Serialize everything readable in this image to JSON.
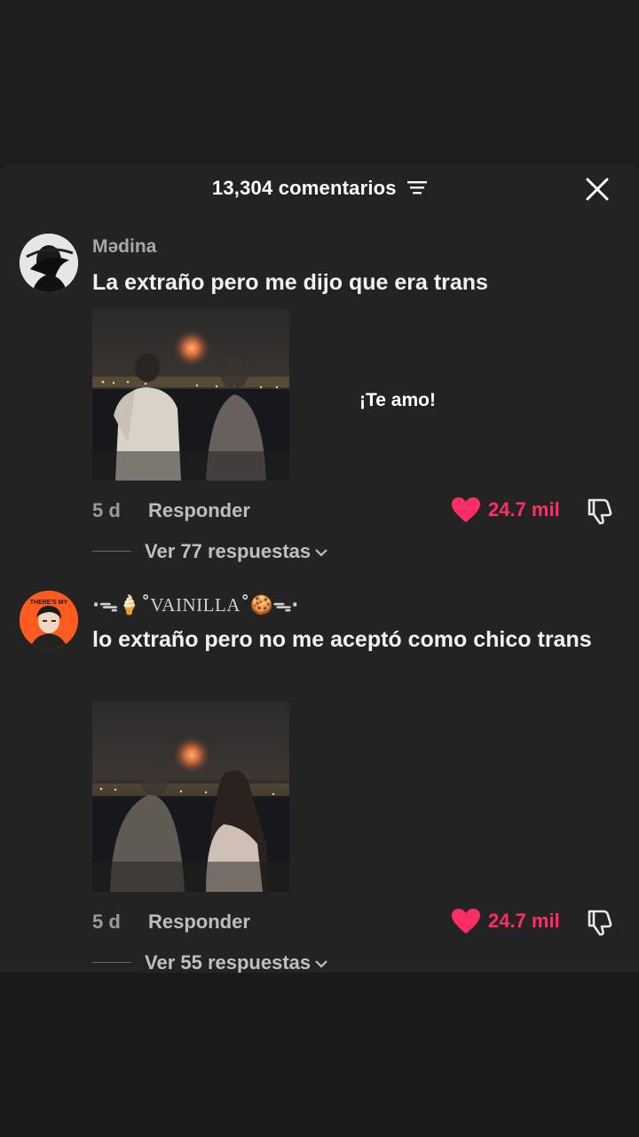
{
  "header": {
    "title": "13,304 comentarios"
  },
  "overlay": {
    "sticker_text": "¡Te amo!"
  },
  "comments": [
    {
      "username": "Mədina",
      "text": "La extraño pero me dijo que era trans",
      "time": "5 d",
      "reply_label": "Responder",
      "likes": "24.7 mil",
      "view_replies": "Ver 77 respuestas"
    },
    {
      "username_prefix": "·ᯓ🍦˚",
      "username": "VAINILLA",
      "username_suffix": "˚🍪ᯓ·",
      "text": "lo extraño pero no me aceptó como chico trans",
      "time": "5 d",
      "reply_label": "Responder",
      "likes": "24.7 mil",
      "view_replies": "Ver 55 respuestas",
      "avatar_badge": "THERE'S MY"
    }
  ],
  "colors": {
    "like": "#ff2d66",
    "sheet_bg": "#232323",
    "avatar2_bg": "#ff5a1f"
  },
  "icons": [
    "filter-icon",
    "close-icon",
    "heart-icon",
    "dislike-icon",
    "chevron-down-icon"
  ]
}
